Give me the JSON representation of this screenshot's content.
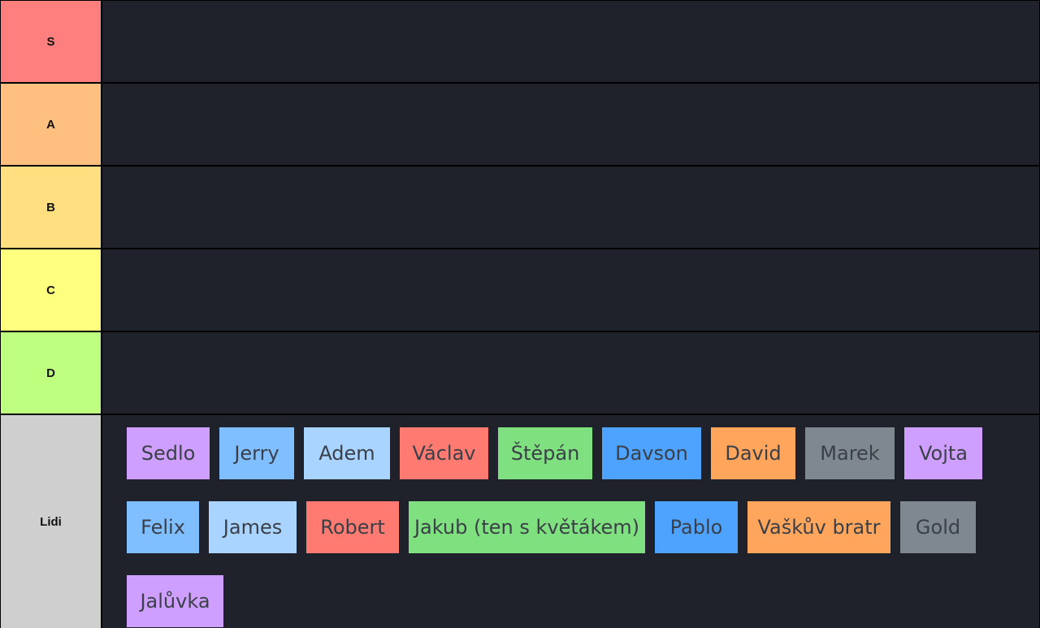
{
  "tiers": [
    {
      "label": "S",
      "color": "#ff7f7f"
    },
    {
      "label": "A",
      "color": "#ffbf7f"
    },
    {
      "label": "B",
      "color": "#ffdf7f"
    },
    {
      "label": "C",
      "color": "#ffff7f"
    },
    {
      "label": "D",
      "color": "#bfff7f"
    }
  ],
  "pool": {
    "label": "Lidi",
    "color": "#cfcfcf",
    "items": [
      {
        "name": "Sedlo",
        "color": "#cf9fff"
      },
      {
        "name": "Jerry",
        "color": "#7fbfff"
      },
      {
        "name": "Adem",
        "color": "#a8d4ff"
      },
      {
        "name": "Václav",
        "color": "#ff7a70"
      },
      {
        "name": "Štěpán",
        "color": "#7fe07f"
      },
      {
        "name": "Davson",
        "color": "#4da3ff"
      },
      {
        "name": "David",
        "color": "#ffa65c"
      },
      {
        "name": "Marek",
        "color": "#7f8790"
      },
      {
        "name": "Vojta",
        "color": "#cf9fff"
      },
      {
        "name": "Felix",
        "color": "#7fbfff"
      },
      {
        "name": "James",
        "color": "#a8d4ff"
      },
      {
        "name": "Robert",
        "color": "#ff7a70"
      },
      {
        "name": "Jakub (ten s květákem)",
        "color": "#7fe07f"
      },
      {
        "name": "Pablo",
        "color": "#4da3ff"
      },
      {
        "name": "Vaškův bratr",
        "color": "#ffa65c"
      },
      {
        "name": "Gold",
        "color": "#7f8790"
      },
      {
        "name": "Jalůvka",
        "color": "#cf9fff"
      }
    ]
  }
}
